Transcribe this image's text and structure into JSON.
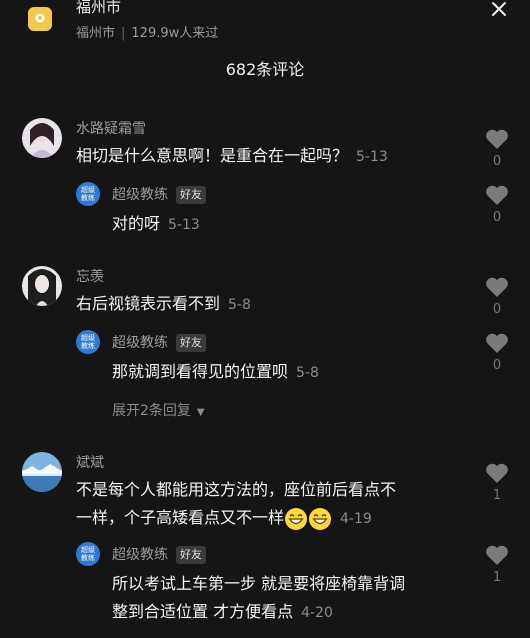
{
  "header": {
    "location_title": "福州市",
    "location_city": "福州市",
    "visits": "129.9w人来过",
    "comment_count_title": "682条评论"
  },
  "comments": [
    {
      "name": "水路疑霜雪",
      "text": "相切是什么意思啊！是重合在一起吗？",
      "date": "5-13",
      "likes": "0",
      "reply": {
        "name": "超级教练",
        "badge": "好友",
        "avatar_text": "超级教练",
        "text": "对的呀",
        "date": "5-13",
        "likes": "0"
      }
    },
    {
      "name": "忘羡",
      "text": "右后视镜表示看不到",
      "date": "5-8",
      "likes": "0",
      "reply": {
        "name": "超级教练",
        "badge": "好友",
        "avatar_text": "超级教练",
        "text": "那就调到看得见的位置呗",
        "date": "5-8",
        "likes": "0"
      },
      "expand_label": "展开2条回复"
    },
    {
      "name": "斌斌",
      "text_line1": "不是每个人都能用这方法的，座位前后看点不",
      "text_line2": "一样，个子高矮看点又不一样",
      "date": "4-19",
      "likes": "1",
      "reply": {
        "name": "超级教练",
        "badge": "好友",
        "avatar_text": "超级教练",
        "text_line1": "所以考试上车第一步 就是要将座椅靠背调",
        "text_line2": "整到合适位置 才方便看点",
        "date": "4-20",
        "likes": "1"
      }
    }
  ],
  "icons": {
    "location": "map-pin-icon",
    "close": "close-icon",
    "like": "heart-icon",
    "expand": "caret-down-icon",
    "emoji": "grin-emoji-icon"
  },
  "colors": {
    "background": "#151515",
    "location_badge": "#f2c94c",
    "coach_avatar": "#2e7bd3"
  }
}
